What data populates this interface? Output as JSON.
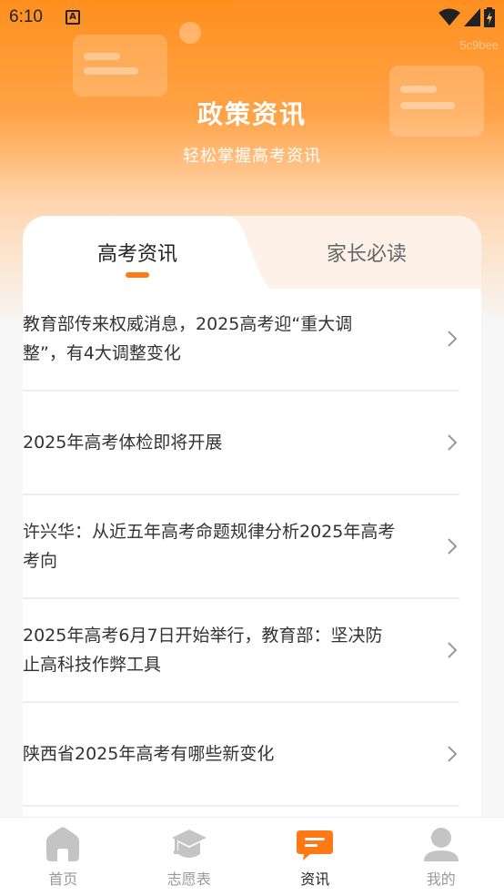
{
  "status_bar": {
    "time": "6:10",
    "app_indicator": "A",
    "watermark": "5c9bee"
  },
  "header": {
    "title": "政策资讯",
    "subtitle": "轻松掌握高考资讯"
  },
  "tabs": [
    {
      "label": "高考资讯",
      "active": true
    },
    {
      "label": "家长必读",
      "active": false
    }
  ],
  "articles": [
    {
      "title": "教育部传来权威消息，2025高考迎“重大调整”，有4大调整变化"
    },
    {
      "title": "2025年高考体检即将开展"
    },
    {
      "title": "许兴华：从近五年高考命题规律分析2025年高考考向"
    },
    {
      "title": "2025年高考6月7日开始举行，教育部：坚决防止高科技作弊工具"
    },
    {
      "title": "陕西省2025年高考有哪些新变化"
    }
  ],
  "bottom_nav": [
    {
      "label": "首页",
      "icon": "home-icon",
      "active": false
    },
    {
      "label": "志愿表",
      "icon": "graduation-cap-icon",
      "active": false
    },
    {
      "label": "资讯",
      "icon": "message-icon",
      "active": true
    },
    {
      "label": "我的",
      "icon": "user-icon",
      "active": false
    }
  ],
  "colors": {
    "accent": "#ff7a14",
    "header_top": "#ff8f1f",
    "tab_inactive_bg": "#fdf1e8",
    "nav_inactive": "#c4c4c4"
  }
}
